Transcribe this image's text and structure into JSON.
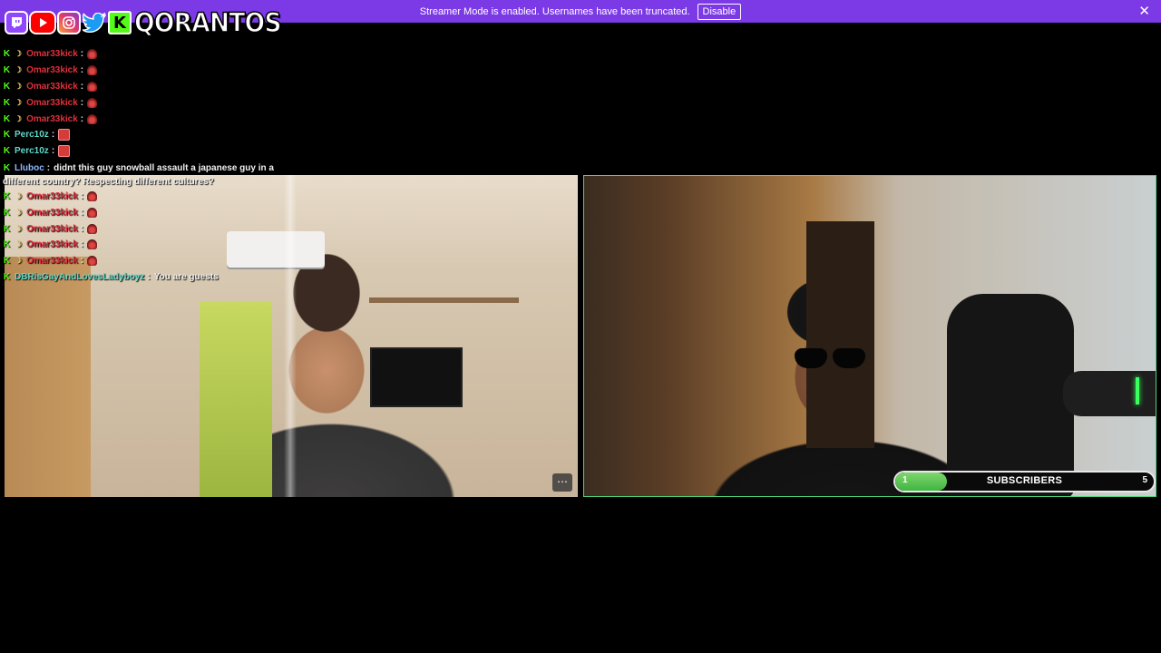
{
  "banner": {
    "message": "Streamer Mode is enabled. Usernames have been truncated.",
    "disable_label": "Disable",
    "close_glyph": "✕",
    "color": "#7c3ae6"
  },
  "socials": {
    "icons": [
      "twitch-icon",
      "youtube-icon",
      "instagram-icon",
      "twitter-icon",
      "kick-icon"
    ],
    "kick_glyph": "K",
    "name": "QORANTOS"
  },
  "chat": {
    "messages": [
      {
        "user": "Omar33kick",
        "color": "#e0303c",
        "emote": "hood",
        "text": ""
      },
      {
        "user": "Omar33kick",
        "color": "#e0303c",
        "emote": "hood",
        "text": ""
      },
      {
        "user": "Omar33kick",
        "color": "#e0303c",
        "emote": "hood",
        "text": ""
      },
      {
        "user": "Omar33kick",
        "color": "#e0303c",
        "emote": "hood",
        "text": ""
      },
      {
        "user": "Omar33kick",
        "color": "#e0303c",
        "emote": "hood",
        "text": ""
      },
      {
        "user": "Perc10z",
        "color": "#5fd7c9",
        "emote": "tile",
        "text": ""
      },
      {
        "user": "Perc10z",
        "color": "#5fd7c9",
        "emote": "tile",
        "text": ""
      },
      {
        "user": "Lluboc",
        "color": "#8fb6ff",
        "emote": "",
        "text": "didnt this guy snowball assault a japanese guy in a different country? Respecting different cultures?"
      },
      {
        "user": "Omar33kick",
        "color": "#e0303c",
        "emote": "hood",
        "text": ""
      },
      {
        "user": "Omar33kick",
        "color": "#e0303c",
        "emote": "hood",
        "text": ""
      },
      {
        "user": "Omar33kick",
        "color": "#e0303c",
        "emote": "hood",
        "text": ""
      },
      {
        "user": "Omar33kick",
        "color": "#e0303c",
        "emote": "hood",
        "text": ""
      },
      {
        "user": "Omar33kick",
        "color": "#e0303c",
        "emote": "hood",
        "text": ""
      },
      {
        "user": "DBRisGayAndLovesLadyboyz",
        "color": "#5fd7c9",
        "emote": "",
        "text": "You are guests"
      }
    ]
  },
  "video_left": {
    "menu_glyph": "⋯"
  },
  "subs_goal": {
    "current": "1",
    "label": "SUBSCRIBERS",
    "goal": "5",
    "progress": 0.2,
    "accent": "#4dd37a"
  }
}
